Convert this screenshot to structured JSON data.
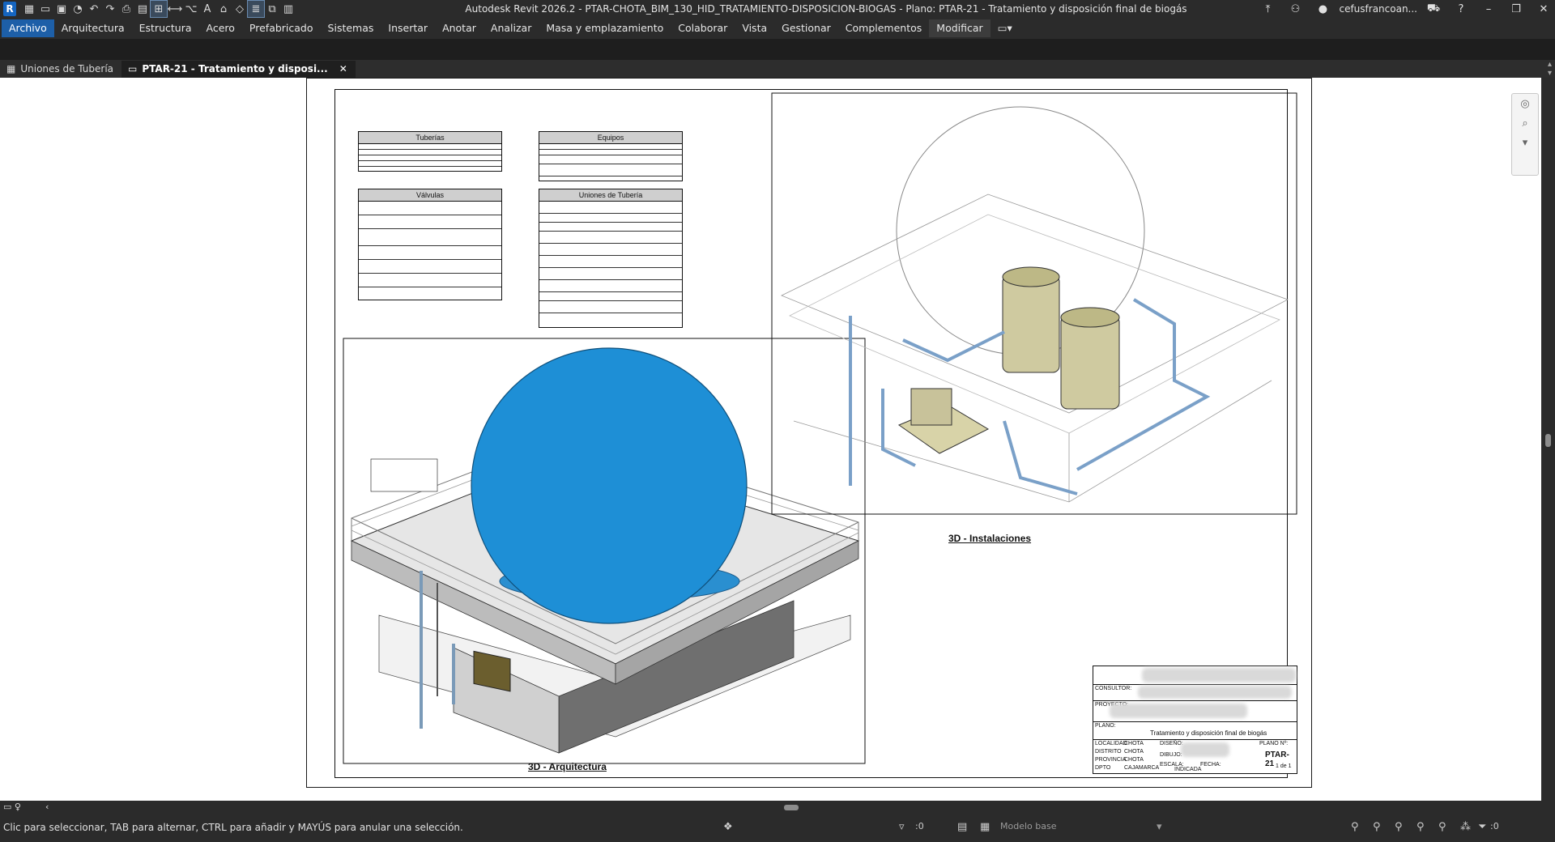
{
  "app": {
    "title": "Autodesk Revit 2026.2 - PTAR-CHOTA_BIM_130_HID_TRATAMIENTO-DISPOSICION-BIOGAS - Plano: PTAR-21 - Tratamiento y disposición final de biogás",
    "logo_letter": "R",
    "user": "cefusfrancoan...",
    "accent_color": "#1d5fa8"
  },
  "menu": {
    "items": [
      "Archivo",
      "Arquitectura",
      "Estructura",
      "Acero",
      "Prefabricado",
      "Sistemas",
      "Insertar",
      "Anotar",
      "Analizar",
      "Masa y emplazamiento",
      "Colaborar",
      "Vista",
      "Gestionar",
      "Complementos",
      "Modificar"
    ]
  },
  "tabs": [
    {
      "label": "Uniones de Tubería"
    },
    {
      "label": "PTAR-21 - Tratamiento y disposi..."
    }
  ],
  "sheet": {
    "schedules": [
      "Tuberías",
      "Equipos",
      "Válvulas",
      "Uniones de Tubería"
    ],
    "view_titles": [
      "3D - Instalaciones",
      "3D - Arquitectura"
    ],
    "titleblock": {
      "plano_label": "PLANO:",
      "plano_name": "Tratamiento y disposición final de biogás",
      "sheet_number": "PTAR-21",
      "consultor": "CONSULTOR:",
      "proyecto": "PROYECTO:",
      "localidad": "LOCALIDAD",
      "localidad_v": "CHOTA",
      "distrito": "DISTRITO",
      "distrito_v": "CHOTA",
      "provincia": "PROVINCIA",
      "provincia_v": "CHOTA",
      "dpto": "DPTO",
      "dpto_v": "CAJAMARCA",
      "diseno": "DISEÑO:",
      "dibujo": "DIBUJO:",
      "escala": "ESCALA:",
      "escala_v": "INDICADA",
      "fecha": "FECHA:",
      "planoa": "PLANO Nº:",
      "page": "1 de 1"
    }
  },
  "status": {
    "hint": "Clic para seleccionar, TAB para alternar, CTRL para añadir y MAYÚS para anular una selección.",
    "count_a": ":0",
    "model": "Modelo base",
    "count_b": ":0"
  }
}
